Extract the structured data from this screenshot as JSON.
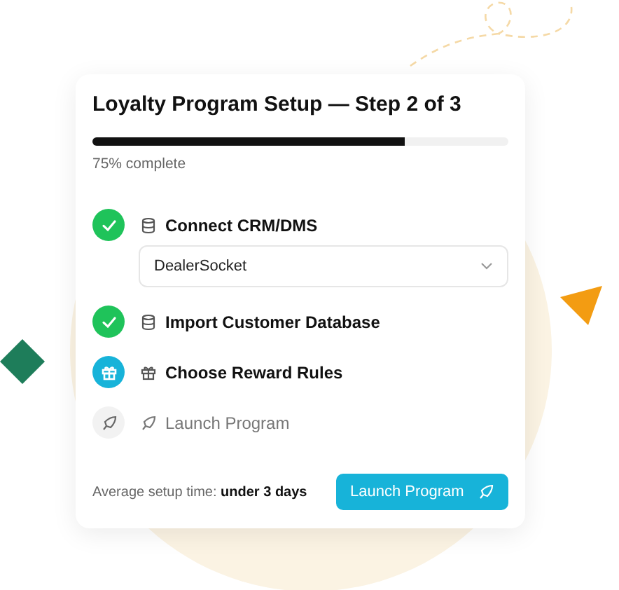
{
  "card": {
    "title": "Loyalty Program Setup — Step 2 of 3",
    "progress": {
      "level": 0.75,
      "label": "75% complete"
    },
    "steps": [
      {
        "label": "Connect CRM/DMS",
        "kind": "done",
        "dropdown": {
          "value": "DealerSocket"
        }
      },
      {
        "label": "Import Customer Database",
        "kind": "done"
      },
      {
        "label": "Choose Reward Rules",
        "kind": "current"
      },
      {
        "label": "Launch Program",
        "kind": "pending"
      }
    ],
    "footer": {
      "text": "Average setup time: **under 3 days**",
      "button": "Launch Program"
    }
  }
}
